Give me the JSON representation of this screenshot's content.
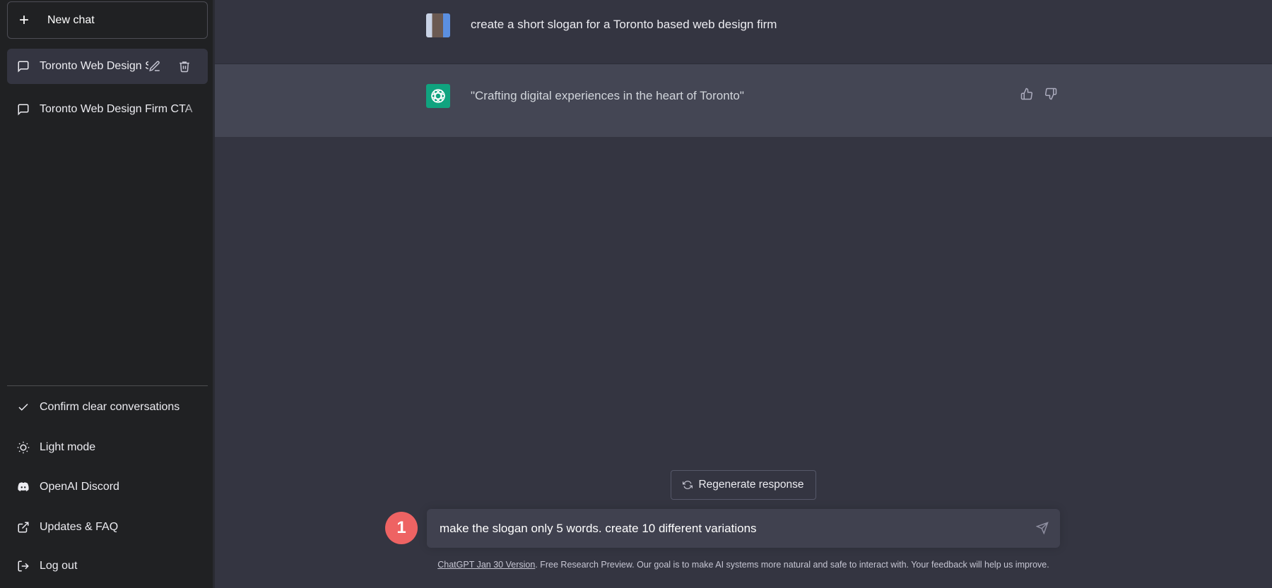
{
  "sidebar": {
    "new_chat": "New chat",
    "conversations": [
      {
        "label": "Toronto Web Design Sl",
        "active": true
      },
      {
        "label": "Toronto Web Design Firm CTA",
        "active": false
      }
    ],
    "bottom": [
      {
        "label": "Confirm clear conversations",
        "icon": "check-icon"
      },
      {
        "label": "Light mode",
        "icon": "sun-icon"
      },
      {
        "label": "OpenAI Discord",
        "icon": "discord-icon"
      },
      {
        "label": "Updates & FAQ",
        "icon": "external-link-icon"
      },
      {
        "label": "Log out",
        "icon": "logout-icon"
      }
    ]
  },
  "messages": [
    {
      "role": "user",
      "text": "create a short slogan for a Toronto based web design firm"
    },
    {
      "role": "assistant",
      "text": "\"Crafting digital experiences in the heart of Toronto\""
    }
  ],
  "regenerate_label": "Regenerate response",
  "input": {
    "value": "make the slogan only 5 words. create 10 different variations"
  },
  "step_badge": "1",
  "footer": {
    "link": "ChatGPT Jan 30 Version",
    "text": ". Free Research Preview. Our goal is to make AI systems more natural and safe to interact with. Your feedback will help us improve."
  },
  "colors": {
    "sidebar": "#202123",
    "main": "#343541",
    "assistant_row": "#444654",
    "brand": "#10a37f",
    "badge": "#ee6363"
  }
}
